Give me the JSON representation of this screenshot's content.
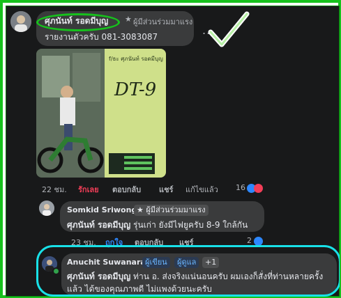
{
  "main_comment": {
    "author": "ศุภนันท์ รอดมีบุญ",
    "badge": "ผู้มีส่วนร่วมมาแรง",
    "text": "รายงานตัวครับ 081-3083087",
    "more_label": "...",
    "photo_caption_top": "f/ธะ ศุภนันท์ รอดมีบุญ",
    "photo_model": "DT-9",
    "time": "22 ชม.",
    "reaction_label": "รักเลย",
    "reply_label": "ตอบกลับ",
    "share_label": "แชร์",
    "edited_label": "แก้ไขแล้ว",
    "reaction_count": "16",
    "accent_color": "#f33e58"
  },
  "reply1": {
    "author": "Somkid Sriwong",
    "badge": "ผู้มีส่วนร่วมมาแรง",
    "mention": "ศุภนันท์ รอดมีบุญ",
    "text": "รุ่นเก่า ยังมีไฟยูครับ 8-9 ใกล้กัน",
    "time": "23 ชม.",
    "reaction_label": "ถูกใจ",
    "reply_label": "ตอบกลับ",
    "share_label": "แชร์",
    "reaction_count": "2",
    "accent_color": "#2d88ff"
  },
  "reply2": {
    "author": "Anuchit Suwanarat",
    "role1": "ผู้เขียน",
    "role2": "ผู้ดูแล",
    "role_more": "+1",
    "mention": "ศุภนันท์ รอดมีบุญ",
    "line1": "ท่าน อ. ส่งจริงแน่นอนครับ ผมเองก็สั่งที่ท่านหลายครั้ง",
    "line2": "แล้ว ได้ของคุณภาพดี ไม่แพงด้วยนะครับ"
  },
  "colors": {
    "frame_green": "#16c21c",
    "highlight_cyan": "#18e1e8",
    "bubble": "#3a3b3c",
    "background": "#18191a"
  }
}
